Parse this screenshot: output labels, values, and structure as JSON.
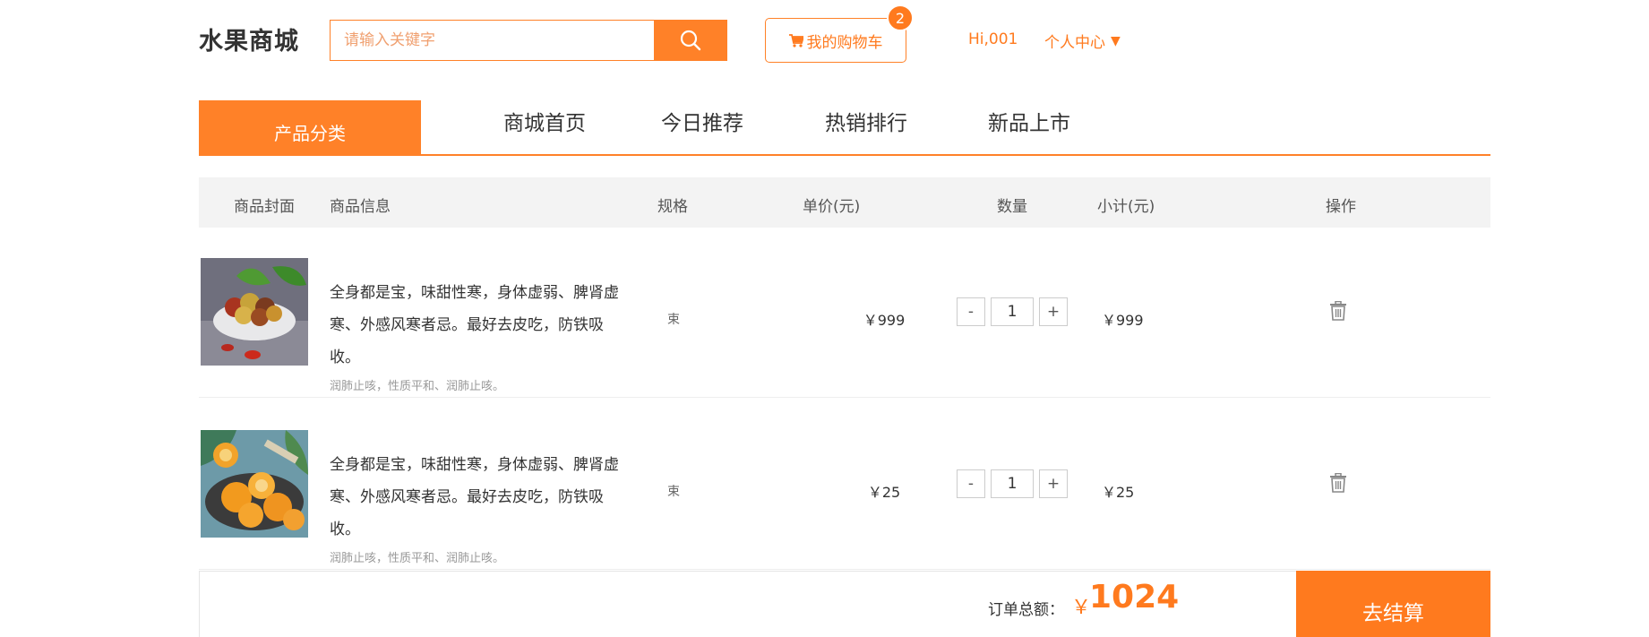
{
  "header": {
    "brand": "水果商城",
    "search_placeholder": "请输入关键字",
    "cart_label": "我的购物车",
    "cart_count": "2",
    "greeting": "Hi,001",
    "user_center": "个人中心",
    "user_center_caret": "▼"
  },
  "nav": {
    "category": "产品分类",
    "links": [
      "商城首页",
      "今日推荐",
      "热销排行",
      "新品上市"
    ]
  },
  "table": {
    "headers": {
      "cover": "商品封面",
      "info": "商品信息",
      "spec": "规格",
      "price": "单价(元)",
      "qty": "数量",
      "subtotal": "小计(元)",
      "action": "操作"
    },
    "rows": [
      {
        "desc": "全身都是宝，味甜性寒，身体虚弱、脾肾虚寒、外感风寒者忌。最好去皮吃，防铁吸收。",
        "sub": "润肺止咳，性质平和、润肺止咳。",
        "spec": "束",
        "price": "￥999",
        "qty": "1",
        "subtotal": "￥999",
        "minus": "-",
        "plus": "+"
      },
      {
        "desc": "全身都是宝，味甜性寒，身体虚弱、脾肾虚寒、外感风寒者忌。最好去皮吃，防铁吸收。",
        "sub": "润肺止咳，性质平和、润肺止咳。",
        "spec": "束",
        "price": "￥25",
        "qty": "1",
        "subtotal": "￥25",
        "minus": "-",
        "plus": "+"
      }
    ]
  },
  "footer": {
    "total_label": "订单总额：",
    "currency": "￥",
    "total": "1024",
    "checkout": "去结算"
  },
  "colors": {
    "accent": "#ff8128",
    "accent_text": "#ff7a1e"
  }
}
